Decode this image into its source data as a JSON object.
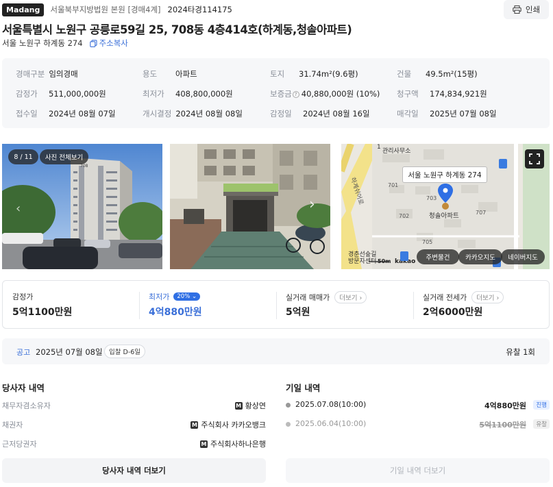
{
  "header": {
    "brand": "Madang",
    "court": "서울북부지방법원 본원 [경매4계]",
    "case_no": "2024타경114175",
    "print_label": "인쇄"
  },
  "address": {
    "title": "서울특별시 노원구 공릉로59길 25, 708동 4층414호(하계동,청솔아파트)",
    "jibun": "서울 노원구 하계동 274",
    "copy_label": "주소복사"
  },
  "info": [
    {
      "k": "경매구분",
      "v": "임의경매"
    },
    {
      "k": "용도",
      "v": "아파트"
    },
    {
      "k": "토지",
      "v": "31.74m²(9.6평)"
    },
    {
      "k": "건물",
      "v": "49.5m²(15평)"
    },
    {
      "k": "감정가",
      "v": "511,000,000원"
    },
    {
      "k": "최저가",
      "v": "408,800,000원"
    },
    {
      "k": "보증금",
      "v": "40,880,000원 (10%)"
    },
    {
      "k": "청구액",
      "v": "174,834,921원"
    },
    {
      "k": "접수일",
      "v": "2024년 08월 07일"
    },
    {
      "k": "개시결정",
      "v": "2024년 08월 08일"
    },
    {
      "k": "감정일",
      "v": "2024년 08월 16일"
    },
    {
      "k": "매각일",
      "v": "2025년 07월 08일"
    }
  ],
  "gallery": {
    "counter": "8 / 11",
    "view_all": "사진 전체보기",
    "building_no": "708"
  },
  "map": {
    "callout": "서울 노원구 하계동 274",
    "office_label": "관리사무소",
    "road_label": "하계쉬어로",
    "apt_label": "청솔아파트",
    "blocks": [
      "701",
      "703",
      "702",
      "707",
      "705",
      "1"
    ],
    "station_label": "경춘선숲길",
    "tenant_label": "방문자센터",
    "scale": "50m",
    "provider": "kakao",
    "btn_nearby": "주변물건",
    "btn_kakao": "카카오지도",
    "btn_naver": "네이버지도"
  },
  "prices": [
    {
      "label": "감정가",
      "value": "5억1100만원"
    },
    {
      "label": "최저가",
      "value": "4억880만원",
      "badge": "20%"
    },
    {
      "label": "실거래 매매가",
      "value": "5억원",
      "more": "더보기"
    },
    {
      "label": "실거래 전세가",
      "value": "2억6000만원",
      "more": "더보기"
    }
  ],
  "notice": {
    "label": "공고",
    "date": "2025년 07월 08일",
    "dday": "입찰 D-6일",
    "fail_count": "유찰 1회"
  },
  "parties": {
    "title": "당사자 내역",
    "rows": [
      {
        "k": "채무자겸소유자",
        "v": "황상연",
        "mark": "M"
      },
      {
        "k": "채권자",
        "v": "주식회사 카카오뱅크",
        "mark": "M"
      },
      {
        "k": "근저당권자",
        "v": "주식회사하나은행",
        "mark": "M"
      }
    ],
    "more_label": "당사자 내역 더보기"
  },
  "history": {
    "title": "기일 내역",
    "rows": [
      {
        "date": "2025.07.08(10:00)",
        "amount": "4억880만원",
        "status": "진행"
      },
      {
        "date": "2025.06.04(10:00)",
        "amount": "5억1100만원",
        "status": "유찰"
      }
    ],
    "more_label": "기일 내역 더보기"
  },
  "colors": {
    "accent": "#2f6fe4",
    "lowest_price": "#3a6fd8",
    "panel_bg": "#f6f7f9"
  }
}
